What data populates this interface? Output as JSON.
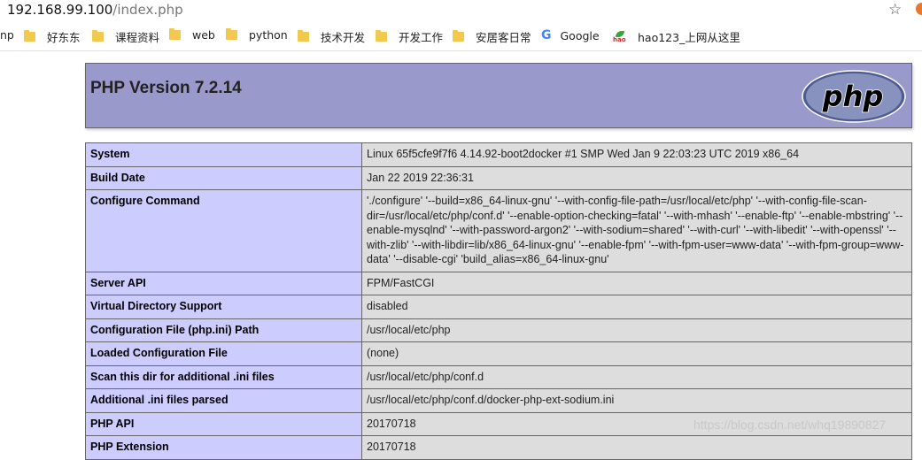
{
  "browser": {
    "url_host": "192.168.99.100",
    "url_path": "/index.php",
    "bookmarks": [
      {
        "label": "np",
        "icon": "none"
      },
      {
        "label": "好东东",
        "icon": "folder-icon"
      },
      {
        "label": "课程资料",
        "icon": "folder-icon"
      },
      {
        "label": "web",
        "icon": "folder-icon"
      },
      {
        "label": "python",
        "icon": "folder-icon"
      },
      {
        "label": "技术开发",
        "icon": "folder-icon"
      },
      {
        "label": "开发工作",
        "icon": "folder-icon"
      },
      {
        "label": "安居客日常",
        "icon": "folder-icon"
      },
      {
        "label": "Google",
        "icon": "google-icon"
      },
      {
        "label": "hao123_上网从这里",
        "icon": "hao123-icon"
      }
    ]
  },
  "php": {
    "title": "PHP Version 7.2.14",
    "logo_text": "php",
    "rows": [
      {
        "key": "System",
        "value": "Linux 65f5cfe9f7f6 4.14.92-boot2docker #1 SMP Wed Jan 9 22:03:23 UTC 2019 x86_64"
      },
      {
        "key": "Build Date",
        "value": "Jan 22 2019 22:36:31"
      },
      {
        "key": "Configure Command",
        "value": "'./configure' '--build=x86_64-linux-gnu' '--with-config-file-path=/usr/local/etc/php' '--with-config-file-scan-dir=/usr/local/etc/php/conf.d' '--enable-option-checking=fatal' '--with-mhash' '--enable-ftp' '--enable-mbstring' '--enable-mysqlnd' '--with-password-argon2' '--with-sodium=shared' '--with-curl' '--with-libedit' '--with-openssl' '--with-zlib' '--with-libdir=lib/x86_64-linux-gnu' '--enable-fpm' '--with-fpm-user=www-data' '--with-fpm-group=www-data' '--disable-cgi' 'build_alias=x86_64-linux-gnu'"
      },
      {
        "key": "Server API",
        "value": "FPM/FastCGI"
      },
      {
        "key": "Virtual Directory Support",
        "value": "disabled"
      },
      {
        "key": "Configuration File (php.ini) Path",
        "value": "/usr/local/etc/php"
      },
      {
        "key": "Loaded Configuration File",
        "value": "(none)"
      },
      {
        "key": "Scan this dir for additional .ini files",
        "value": "/usr/local/etc/php/conf.d"
      },
      {
        "key": "Additional .ini files parsed",
        "value": "/usr/local/etc/php/conf.d/docker-php-ext-sodium.ini"
      },
      {
        "key": "PHP API",
        "value": "20170718"
      },
      {
        "key": "PHP Extension",
        "value": "20170718"
      }
    ]
  },
  "watermark": "https://blog.csdn.net/whq19890827"
}
